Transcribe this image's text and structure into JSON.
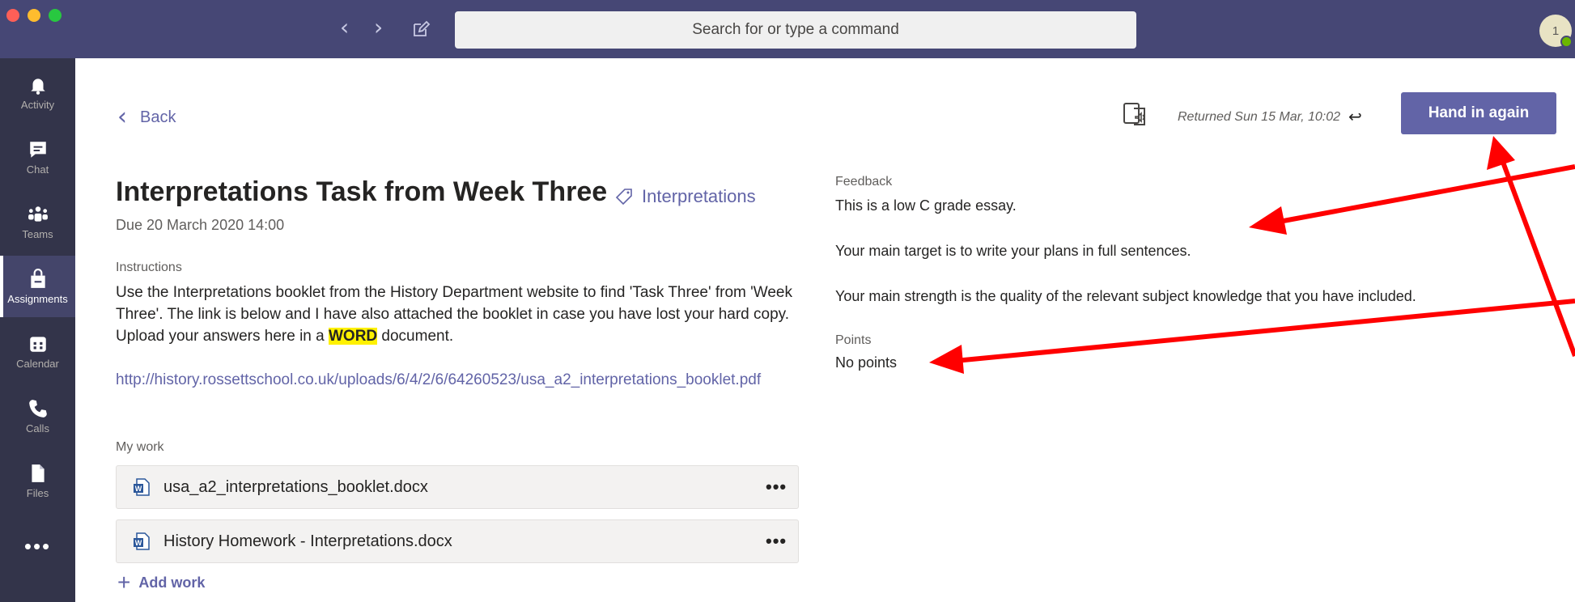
{
  "search": {
    "placeholder": "Search for or type a command"
  },
  "avatar": {
    "initials": "1"
  },
  "rail": {
    "items": [
      {
        "label": "Activity",
        "icon": "bell-icon"
      },
      {
        "label": "Chat",
        "icon": "chat-icon"
      },
      {
        "label": "Teams",
        "icon": "teams-icon"
      },
      {
        "label": "Assignments",
        "icon": "assignments-icon",
        "active": true
      },
      {
        "label": "Calendar",
        "icon": "calendar-icon"
      },
      {
        "label": "Calls",
        "icon": "phone-icon"
      },
      {
        "label": "Files",
        "icon": "file-icon"
      }
    ],
    "more": "•••"
  },
  "header": {
    "back": "Back",
    "returned": "Returned Sun 15 Mar, 10:02",
    "hand_in": "Hand in again"
  },
  "assignment": {
    "title": "Interpretations Task from Week Three",
    "tag": "Interpretations",
    "due": "Due 20 March 2020 14:00",
    "instructions_label": "Instructions",
    "instructions_before": "Use the Interpretations booklet from the History Department website to find 'Task Three' from 'Week Three'. The link is below and I have also attached the booklet in case you have lost your hard copy. Upload your answers here in a ",
    "instructions_highlight": "WORD",
    "instructions_after": " document.",
    "link": "http://history.rossettschool.co.uk/uploads/6/4/2/6/64260523/usa_a2_interpretations_booklet.pdf",
    "my_work_label": "My work",
    "files": [
      {
        "name": "usa_a2_interpretations_booklet.docx",
        "more": "•••"
      },
      {
        "name": "History Homework - Interpretations.docx",
        "more": "•••"
      }
    ],
    "add_work": "Add work"
  },
  "feedback": {
    "label": "Feedback",
    "line1": "This is a low C grade essay.",
    "line2": "Your main target is to write your plans in full sentences.",
    "line3": "Your main strength is the quality of the relevant subject knowledge that you have included.",
    "points_label": "Points",
    "points": "No points"
  },
  "colors": {
    "brand": "#6264a7",
    "titlebar": "#464775",
    "rail": "#33344a",
    "annotation_arrow": "#ff0000",
    "highlight": "#fff100"
  }
}
